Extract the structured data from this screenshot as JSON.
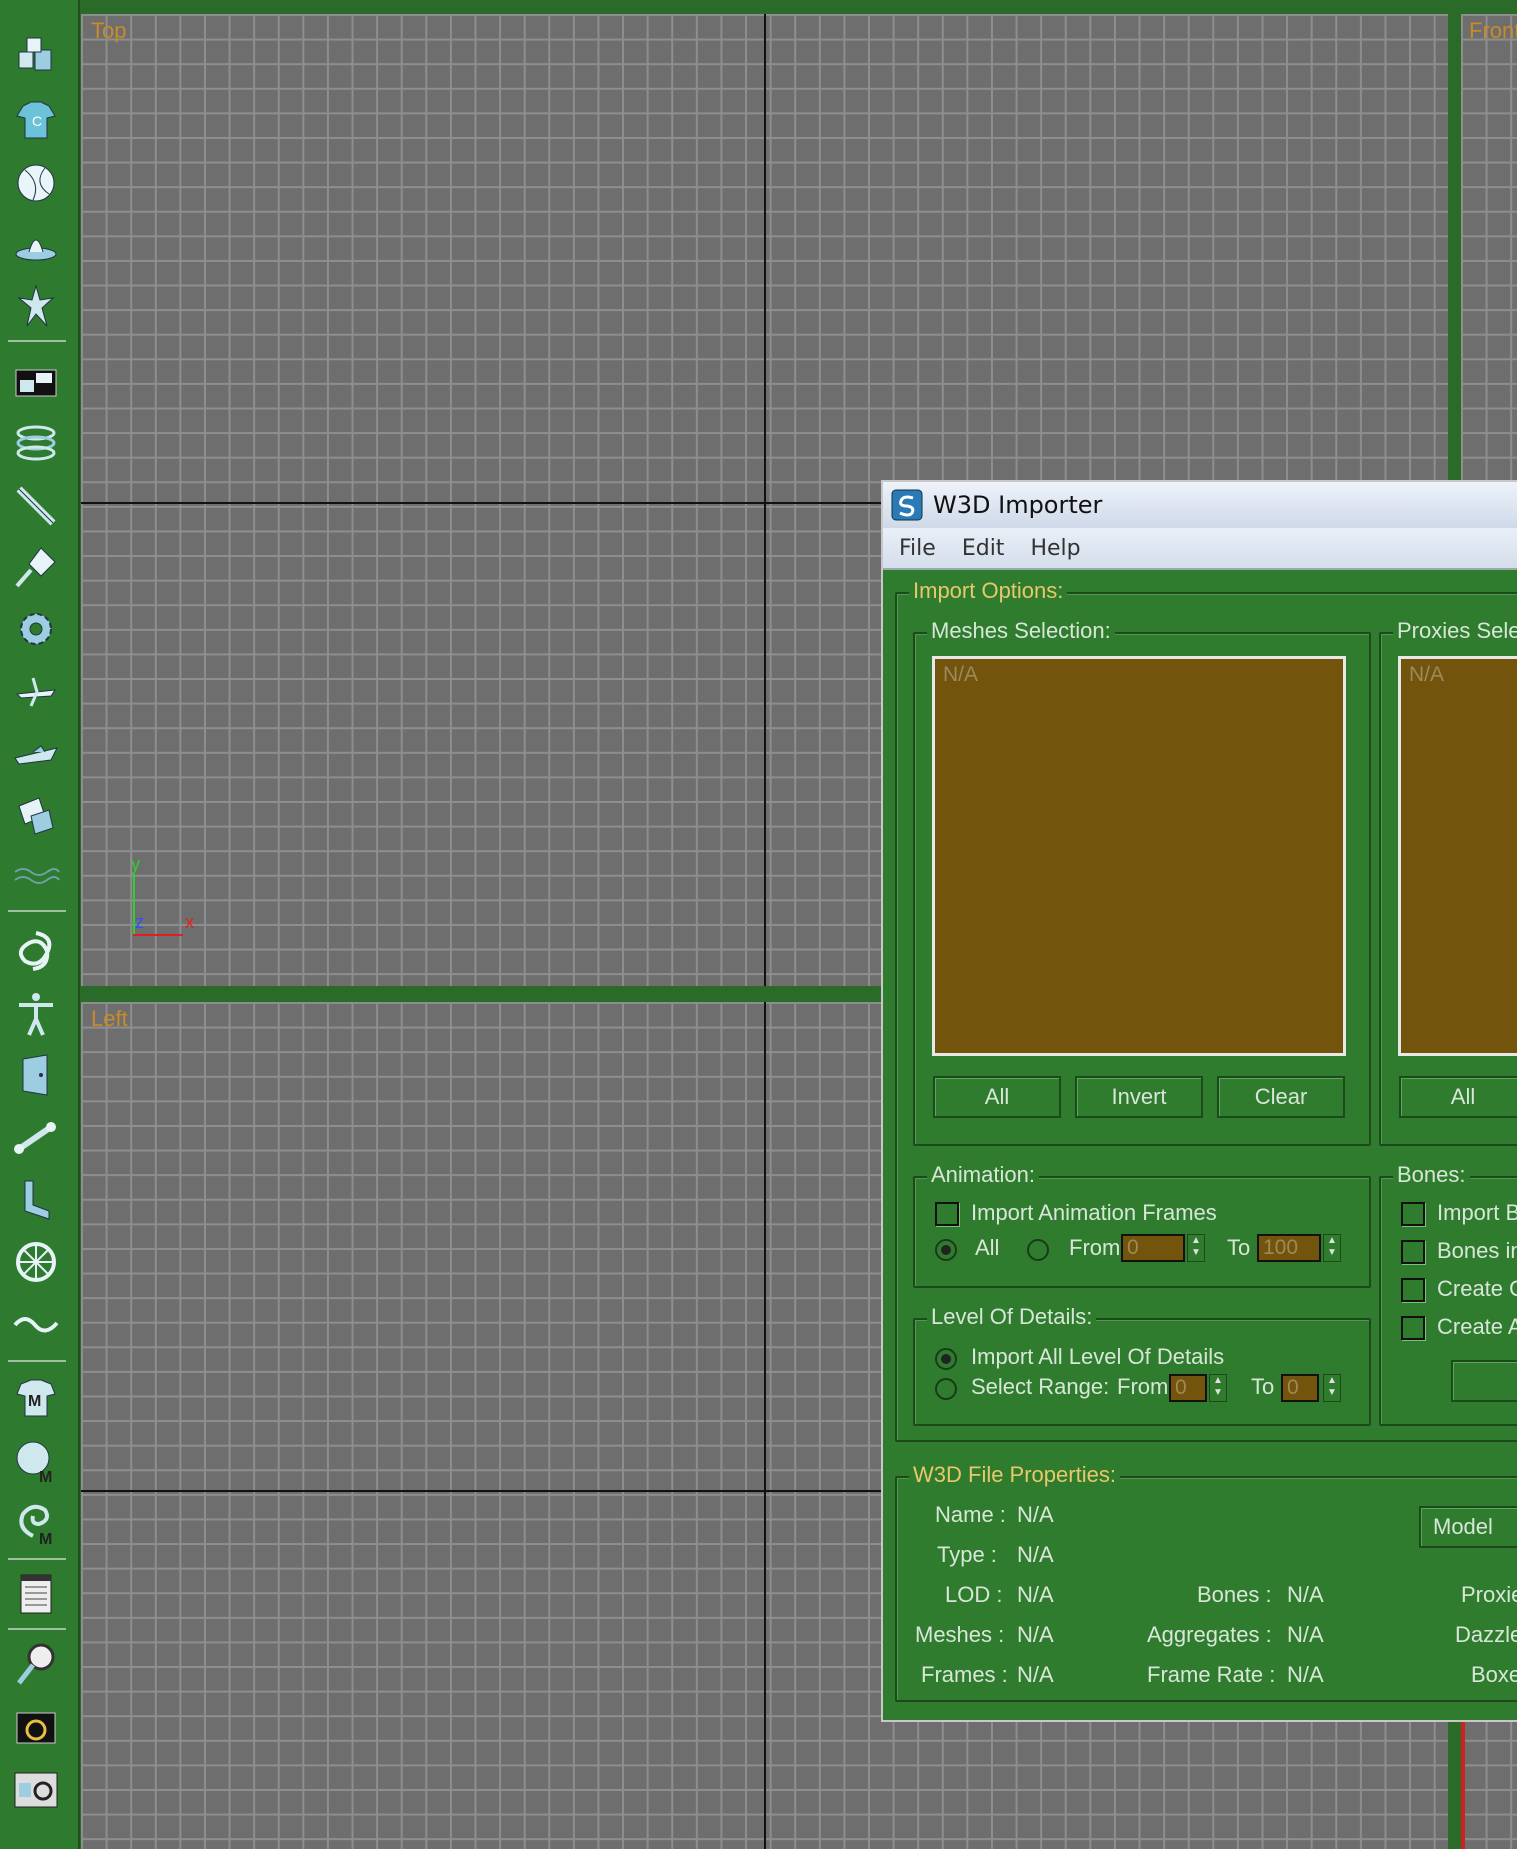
{
  "viewports": {
    "top_label": "Top",
    "front_label": "Front",
    "left_label": "Left",
    "axis_y": "y",
    "axis_z": "z",
    "axis_x": "x"
  },
  "toolbar": {
    "icons": [
      "boxes-icon",
      "shirt-icon",
      "sphere-icon",
      "teapot-icon",
      "figure-icon",
      "panel-icon",
      "coil-icon",
      "wand-icon",
      "compass-icon",
      "gear-icon",
      "plane-icon",
      "ship-icon",
      "stack-icon",
      "wave-icon",
      "knot-icon",
      "biped-icon",
      "door-icon",
      "bone-icon",
      "chair-icon",
      "wheel-icon",
      "curve-icon",
      "material-shirt-icon",
      "material-sphere-icon",
      "material-swirl-icon",
      "list-icon",
      "zoom-icon",
      "camera-icon",
      "render-icon"
    ]
  },
  "dialog": {
    "title": "W3D Importer",
    "menu": [
      "File",
      "Edit",
      "Help"
    ],
    "import_options_title": "Import Options:",
    "meshes_selection_title": "Meshes Selection:",
    "meshes_list_placeholder": "N/A",
    "proxies_selection_title": "Proxies Selec",
    "proxies_list_placeholder": "N/A",
    "meshes_buttons": {
      "all": "All",
      "invert": "Invert",
      "clear": "Clear"
    },
    "proxies_all_button": "All",
    "animation": {
      "title": "Animation:",
      "import_frames_label": "Import Animation Frames",
      "radio_all": "All",
      "from_label": "From",
      "from_value": "0",
      "to_label": "To",
      "to_value": "100"
    },
    "bones": {
      "title": "Bones:",
      "items": [
        "Import Bo",
        "Bones in",
        "Create O",
        "Create A"
      ]
    },
    "lod": {
      "title": "Level Of Details:",
      "import_all_label": "Import All Level Of Details",
      "select_range_label": "Select Range:",
      "from_label": "From",
      "from_value": "0",
      "to_label": "To",
      "to_value": "0"
    },
    "file_props": {
      "title": "W3D File Properties:",
      "name_label": "Name :",
      "name_value": "N/A",
      "type_label": "Type :",
      "type_value": "N/A",
      "lod_label": "LOD :",
      "lod_value": "N/A",
      "meshes_label": "Meshes :",
      "meshes_value": "N/A",
      "frames_label": "Frames :",
      "frames_value": "N/A",
      "bones_label": "Bones :",
      "bones_value": "N/A",
      "aggregates_label": "Aggregates :",
      "aggregates_value": "N/A",
      "frame_rate_label": "Frame Rate :",
      "frame_rate_value": "N/A",
      "model_button": "Model",
      "proxies_label": "Proxie",
      "dazzle_label": "Dazzle",
      "boxes_label": "Boxe"
    }
  }
}
